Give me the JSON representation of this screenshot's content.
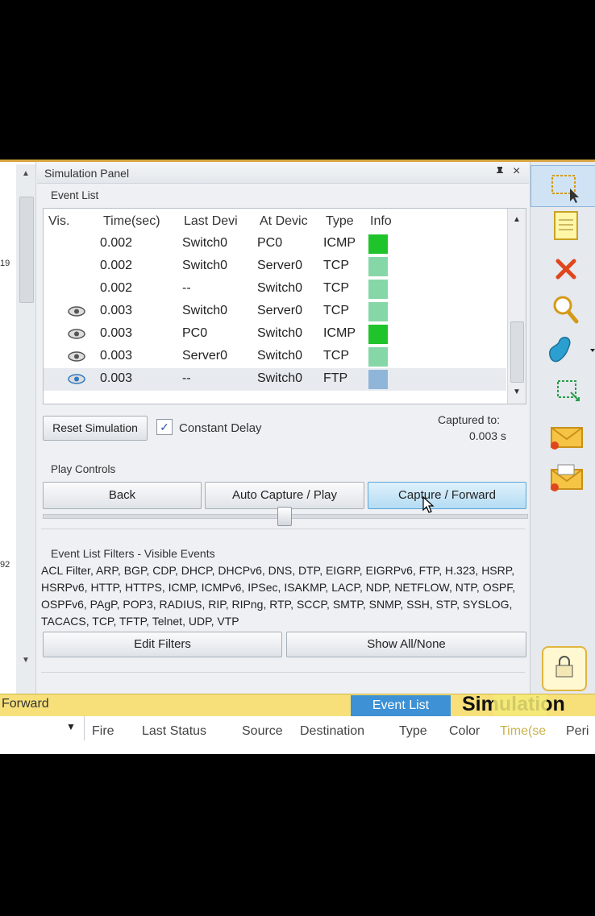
{
  "panel": {
    "title": "Simulation Panel",
    "pin_icon": "pin-icon",
    "close_label": "×",
    "event_list_label": "Event List",
    "columns": [
      "Vis.",
      "Time(sec)",
      "Last Devi",
      "At Devic",
      "Type",
      "Info"
    ],
    "rows": [
      {
        "visible": false,
        "time": "0.002",
        "last": "Switch0",
        "at": "PC0",
        "type": "ICMP",
        "color": "#1fc32a"
      },
      {
        "visible": false,
        "time": "0.002",
        "last": "Switch0",
        "at": "Server0",
        "type": "TCP",
        "color": "#86d7a7"
      },
      {
        "visible": false,
        "time": "0.002",
        "last": "--",
        "at": "Switch0",
        "type": "TCP",
        "color": "#86d7a7"
      },
      {
        "visible": true,
        "time": "0.003",
        "last": "Switch0",
        "at": "Server0",
        "type": "TCP",
        "color": "#86d7a7"
      },
      {
        "visible": true,
        "time": "0.003",
        "last": "PC0",
        "at": "Switch0",
        "type": "ICMP",
        "color": "#1fc32a"
      },
      {
        "visible": true,
        "time": "0.003",
        "last": "Server0",
        "at": "Switch0",
        "type": "TCP",
        "color": "#86d7a7"
      },
      {
        "visible": true,
        "time": "0.003",
        "last": "--",
        "at": "Switch0",
        "type": "FTP",
        "color": "#8fb6d8",
        "selected": true
      }
    ],
    "reset_label": "Reset Simulation",
    "constant_delay_label": "Constant Delay",
    "constant_delay_checked": true,
    "captured_label": "Captured to:",
    "captured_value": "0.003 s",
    "play_controls_label": "Play Controls",
    "back_label": "Back",
    "auto_capture_label": "Auto Capture / Play",
    "capture_forward_label": "Capture / Forward",
    "filters_label": "Event List Filters - Visible Events",
    "filters_text": "ACL Filter, ARP, BGP, CDP, DHCP, DHCPv6, DNS, DTP, EIGRP, EIGRPv6, FTP, H.323, HSRP, HSRPv6, HTTP, HTTPS, ICMP, ICMPv6, IPSec, ISAKMP, LACP, NDP, NETFLOW, NTP, OSPF, OSPFv6, PAgP, POP3, RADIUS, RIP, RIPng, RTP, SCCP, SMTP, SNMP, SSH, STP, SYSLOG, TACACS, TCP, TFTP, Telnet, UDP, VTP",
    "edit_filters_label": "Edit Filters",
    "show_all_label": "Show All/None"
  },
  "left": {
    "num1": "19",
    "num2": "92"
  },
  "toolbar": {
    "items": [
      "select-icon",
      "note-icon",
      "delete-icon",
      "inspect-icon",
      "draw-shape-icon",
      "resize-icon",
      "add-simple-pdu-icon",
      "add-complex-pdu-icon"
    ]
  },
  "bottom": {
    "forward_label": "Forward",
    "event_list_label": "Event List",
    "simulation_label": "Simulation",
    "columns": [
      "Fire",
      "Last Status",
      "Source",
      "Destination",
      "Type",
      "Color",
      "Time(se",
      "Peri"
    ]
  },
  "colors": {
    "accent": "#3d91d4",
    "bar": "#f7e07a",
    "selected_row": "#e7ebf0"
  }
}
